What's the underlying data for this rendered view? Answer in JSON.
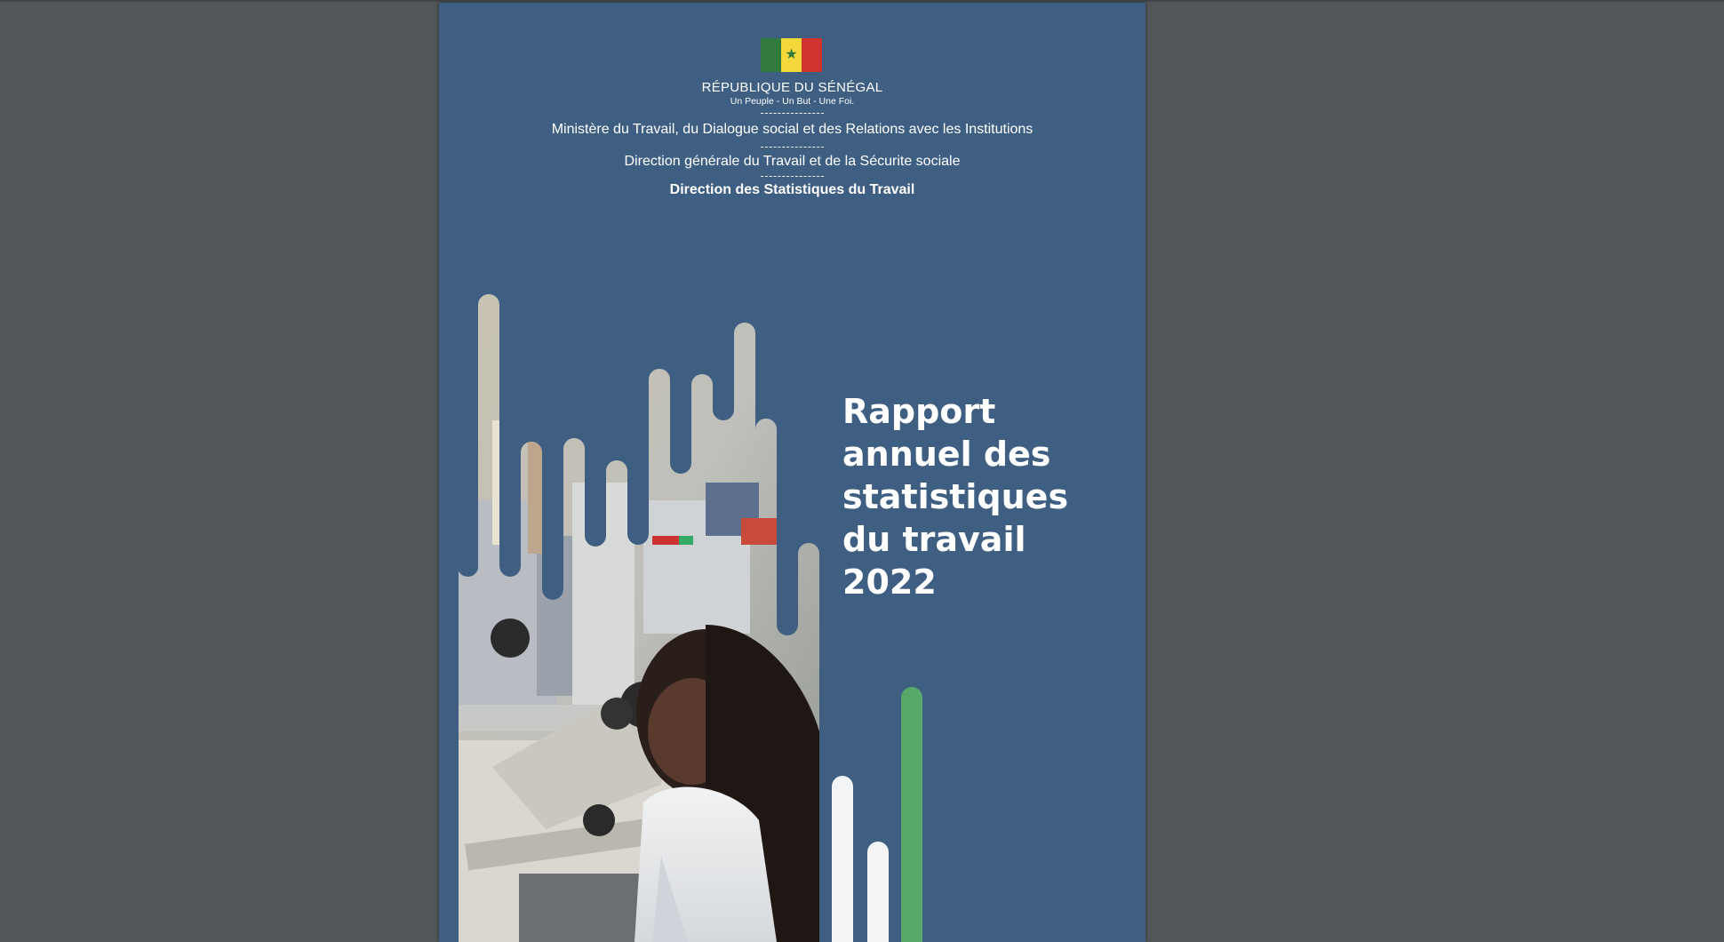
{
  "header": {
    "country": "RÉPUBLIQUE DU SÉNÉGAL",
    "motto": "Un Peuple - Un But -  Une Foi.",
    "ministry": "Ministère du Travail, du Dialogue social et des Relations avec les Institutions",
    "direction_generale": "Direction générale du Travail et de la Sécurite sociale",
    "direction": "Direction des Statistiques du Travail"
  },
  "title": {
    "line1": "Rapport",
    "line2": "annuel des",
    "line3": "statistiques",
    "line4": "du travail",
    "line5": "2022"
  },
  "colors": {
    "page_background": "#3f5f82",
    "viewer_background": "#525659",
    "accent_green": "#58a86a",
    "accent_white": "#f2f4f6"
  },
  "icons": {
    "flag": "senegal-flag-icon",
    "star": "green-star-icon"
  }
}
